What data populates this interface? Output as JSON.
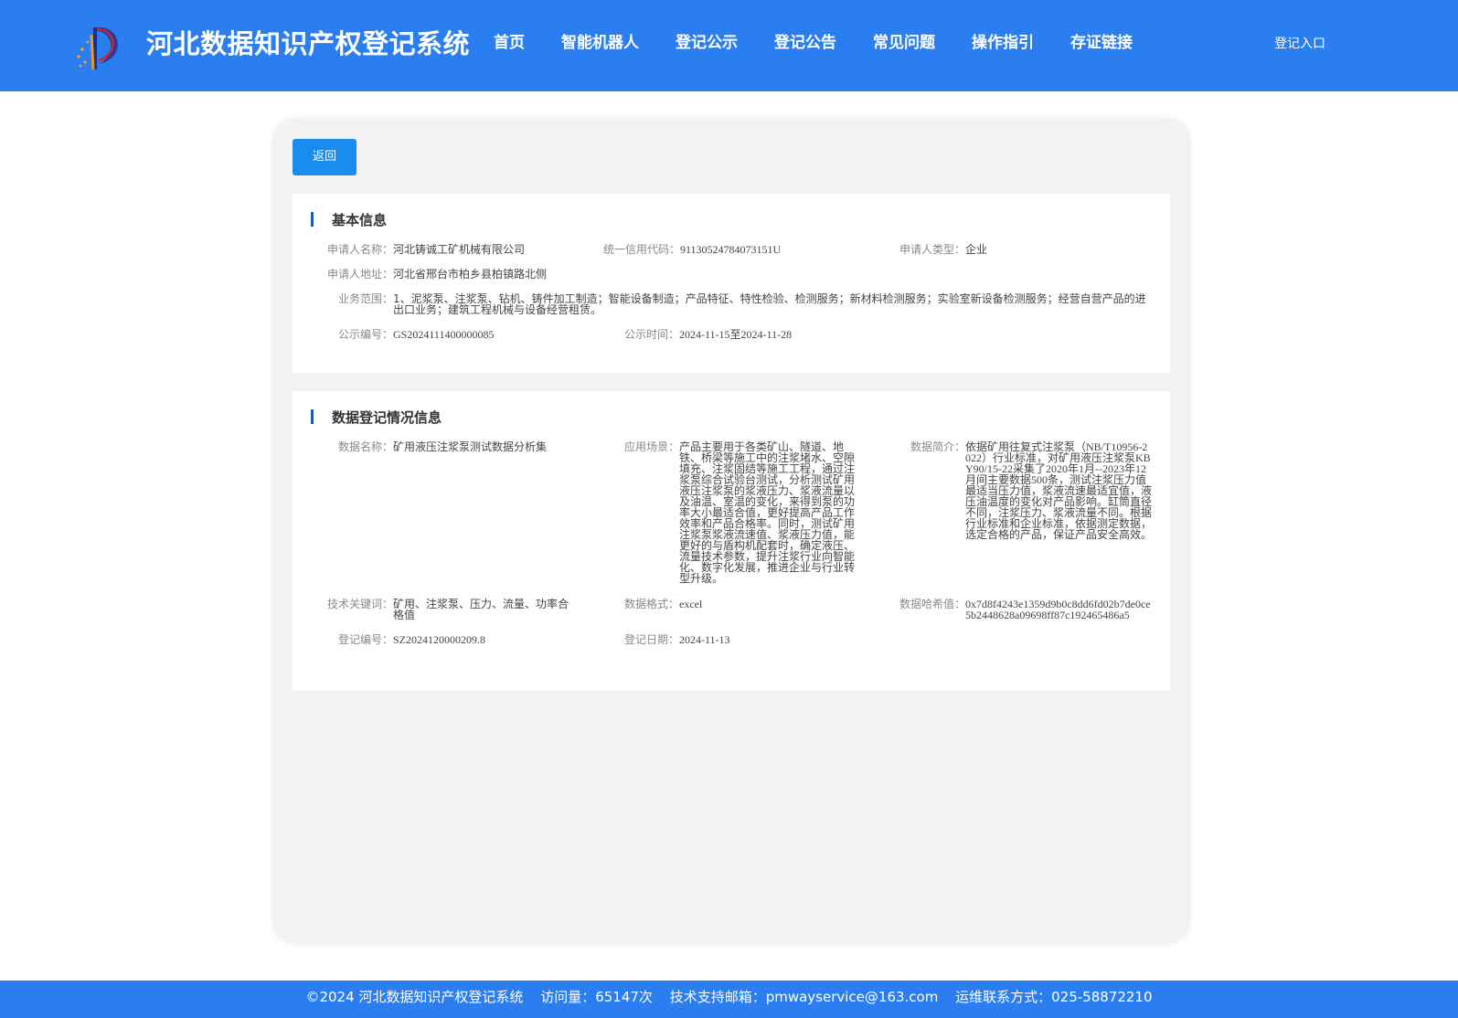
{
  "header": {
    "site_title": "河北数据知识产权登记系统",
    "nav": [
      "首页",
      "智能机器人",
      "登记公示",
      "登记公告",
      "常见问题",
      "操作指引",
      "存证链接"
    ],
    "login": "登记入口"
  },
  "toolbar": {
    "back_label": "返回"
  },
  "basic_info": {
    "title": "基本信息",
    "applicant_name_label": "申请人名称：",
    "applicant_name": "河北铸诚工矿机械有限公司",
    "credit_code_label": "统一信用代码：",
    "credit_code": "91130524784073151U",
    "applicant_type_label": "申请人类型：",
    "applicant_type": "企业",
    "address_label": "申请人地址：",
    "address": "河北省邢台市柏乡县柏镇路北侧",
    "business_scope_label": "业务范围：",
    "business_scope": "1、泥浆泵、注浆泵、钻机、铸件加工制造；智能设备制造；产品特征、特性检验、检测服务；新材料检测服务；实验室新设备检测服务；经营自营产品的进出口业务；建筑工程机械与设备经营租赁。",
    "notice_no_label": "公示编号：",
    "notice_no": "GS2024111400000085",
    "notice_time_label": "公示时间：",
    "notice_time": "2024-11-15至2024-11-28"
  },
  "data_info": {
    "title": "数据登记情况信息",
    "data_name_label": "数据名称：",
    "data_name": "矿用液压注浆泵测试数据分析集",
    "scenario_label": "应用场景：",
    "scenario": "产品主要用于各类矿山、隧道、地铁、桥梁等施工中的注浆堵水、空隙填充、注浆固结等施工工程，通过注浆泵综合试验台测试，分析测试矿用液压注浆泵的浆液压力、浆液流量以及油温、室温的变化，来得到泵的功率大小最适合值，更好提高产品工作效率和产品合格率。同时，测试矿用注浆泵浆液流速值、浆液压力值，能更好的与盾构机配套时，确定液压、流量技术参数，提升注浆行业向智能化、数字化发展，推进企业与行业转型升级。",
    "summary_label": "数据简介：",
    "summary": "依据矿用往复式注浆泵（NB/T10956-2022）行业标准，对矿用液压注浆泵KBY90/15-22采集了2020年1月--2023年12月间主要数据500条，测试注浆压力值最适当压力值，浆液流速最适宜值，液压油温度的变化对产品影响。缸筒直径不同，注浆压力、浆液流量不同。根据行业标准和企业标准，依据测定数据，选定合格的产品，保证产品安全高效。",
    "keywords_label": "技术关键词：",
    "keywords": "矿用、注浆泵、压力、流量、功率合格值",
    "format_label": "数据格式：",
    "format": "excel",
    "hash_label": "数据哈希值：",
    "hash": "0x7d8f4243e1359d9b0c8dd6fd02b7de0ce5b2448628a09698ff87c192465486a5",
    "reg_no_label": "登记编号：",
    "reg_no": "SZ2024120000209.8",
    "reg_date_label": "登记日期：",
    "reg_date": "2024-11-13"
  },
  "footer": {
    "copyright": "©2024 河北数据知识产权登记系统",
    "visits": "访问量：65147次",
    "support": "技术支持邮箱：pmwayservice@163.com",
    "contact": "运维联系方式：025-58872210"
  },
  "colors": {
    "header_bg": "#2b7ef0",
    "button_bg": "#1a8cf0",
    "section_bar": "#1c5bb5",
    "panel_bg": "#f2f2f2"
  }
}
